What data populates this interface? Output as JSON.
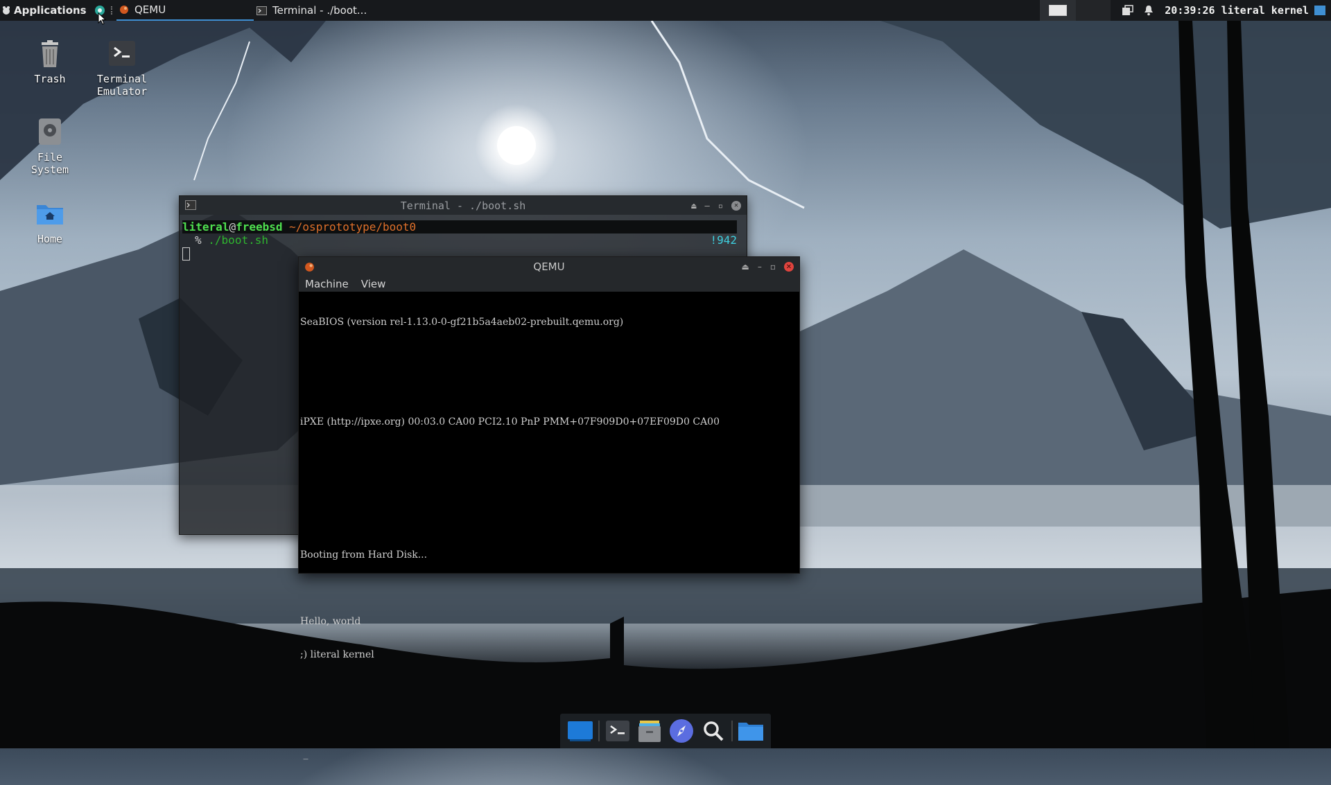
{
  "top_panel": {
    "applications_label": "Applications",
    "tasks": [
      {
        "label": "QEMU",
        "active": true
      },
      {
        "label": "Terminal - ./boot...",
        "active": false
      }
    ],
    "clock": "20:39:26",
    "user": "literal kernel"
  },
  "desktop_icons": [
    {
      "label": "Trash",
      "icon": "trash-icon"
    },
    {
      "label": "Terminal\nEmulator",
      "icon": "terminal-icon"
    },
    {
      "label": "File\nSystem",
      "icon": "drive-icon"
    },
    {
      "label": "Home",
      "icon": "home-folder-icon"
    }
  ],
  "terminal": {
    "title": "Terminal - ./boot.sh",
    "prompt_user": "literal",
    "prompt_at": "@",
    "prompt_host": "freebsd",
    "prompt_path": "~/osprototype/boot0",
    "prompt_symbol": "%",
    "command": "./boot.sh",
    "history_number": "!942"
  },
  "qemu": {
    "title": "QEMU",
    "menu": [
      "Machine",
      "View"
    ],
    "screen_lines": [
      "SeaBIOS (version rel-1.13.0-0-gf21b5a4aeb02-prebuilt.qemu.org)",
      "",
      "",
      "iPXE (http://ipxe.org) 00:03.0 CA00 PCI2.10 PnP PMM+07F909D0+07EF09D0 CA00",
      "",
      "",
      "",
      "Booting from Hard Disk...",
      "",
      "Hello, world",
      ";) literal kernel",
      "",
      "",
      " _"
    ]
  },
  "dock": {
    "items": [
      "desktop-icon",
      "terminal-icon",
      "file-manager-icon",
      "web-browser-icon",
      "app-finder-icon",
      "folder-icon"
    ]
  },
  "colors": {
    "accent": "#3f8fd2",
    "prompt_user": "#4fe04f",
    "prompt_host": "#4fe04f",
    "prompt_path": "#e0702a",
    "command": "#2fb62f",
    "history": "#3fd0e0",
    "qemu_close": "#e0443e"
  }
}
